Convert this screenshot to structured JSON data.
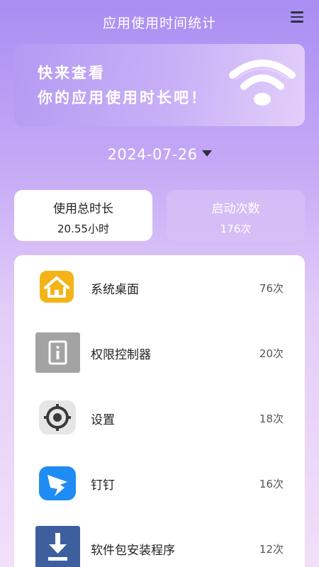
{
  "header": {
    "title": "应用使用时间统计",
    "menu_icon": "menu-icon"
  },
  "banner": {
    "line1": "快来查看",
    "line2": "你的应用使用时长吧！",
    "icon": "wifi-icon"
  },
  "date_picker": {
    "value": "2024-07-26",
    "icon": "caret-down-icon"
  },
  "stats": {
    "total_time": {
      "label": "使用总时长",
      "value": "20.55小时"
    },
    "launch_count": {
      "label": "启动次数",
      "value": "176次"
    }
  },
  "apps": [
    {
      "name": "系统桌面",
      "count": "76次",
      "icon": "home-icon",
      "color": "#f4b418"
    },
    {
      "name": "权限控制器",
      "count": "20次",
      "icon": "permission-controller-icon",
      "color": "#a3a3a3"
    },
    {
      "name": "设置",
      "count": "18次",
      "icon": "settings-gear-icon",
      "color": "#e6e6e6"
    },
    {
      "name": "钉钉",
      "count": "16次",
      "icon": "dingtalk-icon",
      "color": "#1f8cf3"
    },
    {
      "name": "软件包安装程序",
      "count": "12次",
      "icon": "download-installer-icon",
      "color": "#3e5f9e"
    }
  ],
  "colors": {
    "accent_purple": "#a98ef3",
    "card_white": "#ffffff"
  }
}
